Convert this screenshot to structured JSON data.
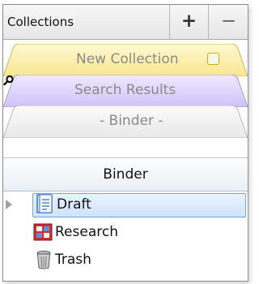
{
  "header": {
    "title": "Collections",
    "add_button": "+",
    "remove_button": "−"
  },
  "tabs": [
    {
      "label": "New Collection",
      "color": "#fdf0b4"
    },
    {
      "label": "Search Results",
      "color": "#ddd4fb"
    },
    {
      "label": "- Binder -",
      "color": "#f2f2f2"
    }
  ],
  "binder_bar": {
    "label": "Binder"
  },
  "tree": {
    "items": [
      {
        "label": "Draft",
        "icon": "draft-icon",
        "selected": true
      },
      {
        "label": "Research",
        "icon": "research-icon",
        "selected": false
      },
      {
        "label": "Trash",
        "icon": "trash-icon",
        "selected": false
      }
    ]
  }
}
